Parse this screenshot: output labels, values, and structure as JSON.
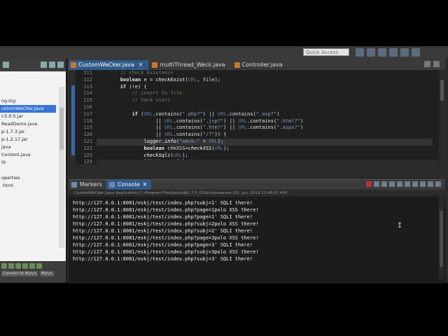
{
  "toolbar": {
    "quick_access": "Quick Access"
  },
  "explorer": {
    "items": [
      "",
      "",
      "",
      "og.log",
      "ustomWeCker.java",
      "i-5.0.5.jar",
      "ReadDemo.java",
      "p-1.7.3.jar",
      "p-1.2.17.jar",
      "java",
      "Content.java",
      "th",
      "",
      "operties",
      ".html"
    ],
    "selected_index": 4,
    "bottom_buttons": [
      "Connect to Mylyn",
      "Mylyn"
    ]
  },
  "editor": {
    "tabs": [
      {
        "label": "CustomWeCker.java",
        "active": true
      },
      {
        "label": "multiThread_Weck.java",
        "active": false
      },
      {
        "label": "Controller.java",
        "active": false
      }
    ],
    "line_numbers": [
      "111",
      "112",
      "113",
      "114",
      "115",
      "116",
      "117",
      "118",
      "119",
      "120",
      "121",
      "122",
      "123",
      "124"
    ],
    "highlight_line": 121
  },
  "console": {
    "tabs": [
      {
        "label": "Markers",
        "active": false
      },
      {
        "label": "Console",
        "active": true
      }
    ],
    "path": "CustomWeCker [Java Application] C:\\Program Files\\Java\\jdk1.7.0_02\\bin\\javaw.exe (02. Jun. 2014 12:48:05 AM)",
    "lines": [
      "http://127.0.0.1:8081/eskj/test/index.php?subj=1' SQLI there!",
      "http://127.0.0.1:8081/eskj/test/index.php?page=1polo XSS there!",
      "http://127.0.0.1:8081/eskj/test/index.php?page=1' SQLI there!",
      "http://127.0.0.1:8081/eskj/test/index.php?subj=2polo XSS there!",
      "http://127.0.0.1:8081/eskj/test/index.php?subj=2' SQLI there!",
      "http://127.0.0.1:8081/eskj/test/index.php?page=3polo XSS there!",
      "http://127.0.0.1:8081/eskj/test/index.php?page=3' SQLI there!",
      "http://127.0.0.1:8081/eskj/test/index.php?subj=3polo XSS there!",
      "http://127.0.0.1:8081/eskj/test/index.php?subj=3' SQLI there!"
    ]
  },
  "code": {
    "l111": "// check Existence",
    "l112_kw": "boolean",
    "l112_a": " e = ",
    "l112_m": "checkExist",
    "l112_b": "(",
    "l112_v": "URL",
    "l112_c": ", file);",
    "l113_kw": "if",
    "l113_a": " (!e) {",
    "l114": "// insert to file",
    "l115": "// hack start",
    "l117_kw": "if",
    "l117_a": " (",
    "l117_v1": "URL",
    "l117_b": ".contains(",
    "l117_s1": "\".php?\"",
    "l117_c": ") || ",
    "l117_v2": "URL",
    "l117_d": ".contains(",
    "l117_s2": "\".asp?\"",
    "l117_e": ")",
    "l118_a": "|| ",
    "l118_v1": "URL",
    "l118_b": ".contains(",
    "l118_s1": "\".jsp?\"",
    "l118_c": ") || ",
    "l118_v2": "URL",
    "l118_d": ".contains(",
    "l118_s2": "\".html?\"",
    "l118_e": ")",
    "l119_a": "|| ",
    "l119_v1": "URL",
    "l119_b": ".contains(",
    "l119_s1": "\".htm?\"",
    "l119_c": ") || ",
    "l119_v2": "URL",
    "l119_d": ".contains(",
    "l119_s2": "\".aspx?\"",
    "l119_e": ")",
    "l120_a": "|| ",
    "l120_v": "URL",
    "l120_b": ".contains(",
    "l120_s": "\"/?\"",
    "l120_c": ")) {",
    "l121_a": "logger.",
    "l121_m": "info",
    "l121_b": "(",
    "l121_s": "\"weck:\"",
    "l121_c": " + ",
    "l121_v": "URL",
    "l121_d": ");",
    "l122_kw": "boolean",
    "l122_a": " chkXSS=",
    "l122_m": "checkXSS",
    "l122_b": "(",
    "l122_v": "URL",
    "l122_c": ");",
    "l123_m": "checkSqli",
    "l123_a": "(",
    "l123_v": "URL",
    "l123_b": ");",
    "l124_kw": "if",
    "l124_a": "(chkXSS==false)"
  },
  "colors": {
    "accent": "#2f5a8a",
    "selection": "#3875d7"
  }
}
